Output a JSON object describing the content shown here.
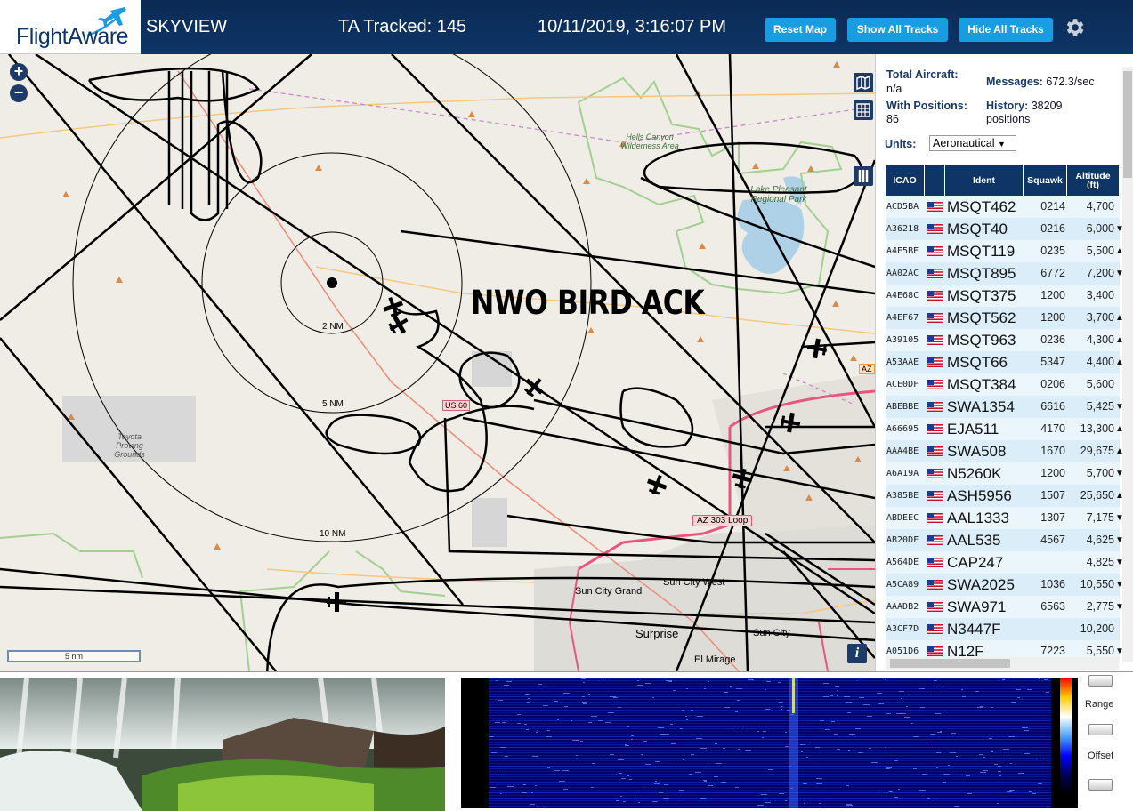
{
  "header": {
    "logo": "FlightAware",
    "app_title": "SKYVIEW",
    "tracked": "TA Tracked: 145",
    "datetime": "10/11/2019, 3:16:07 PM",
    "buttons": {
      "reset": "Reset Map",
      "show_all": "Show All Tracks",
      "hide_all": "Hide All Tracks"
    },
    "brand_color": "#1a9de0",
    "bar_color": "#0e3566"
  },
  "map": {
    "zoom_in": "+",
    "zoom_out": "−",
    "overlay_text": "NWO BIRD ACK",
    "ring_labels": [
      "2 NM",
      "5 NM",
      "10 NM"
    ],
    "place_labels": {
      "hells_canyon": "Hells Canyon Wilderness Area",
      "lake_pleasant": "Lake Pleasant Regional Park",
      "toyota": "Toyota Proving Grounds",
      "sun_city_grand": "Sun City Grand",
      "sun_city_west": "Sun City West",
      "surprise": "Surprise",
      "sun_city": "Sun City",
      "el_mirage": "El Mirage",
      "loop303": "AZ 303 Loop",
      "us60": "US 60",
      "az": "AZ"
    },
    "scale": "5 nm",
    "info": "i"
  },
  "sidebar": {
    "total_aircraft_label": "Total Aircraft:",
    "total_aircraft_value": "n/a",
    "messages_label": "Messages:",
    "messages_value": "672.3/sec",
    "with_positions_label": "With Positions:",
    "with_positions_value": "86",
    "history_label": "History:",
    "history_value": "38209",
    "history_unit": "positions",
    "units_label": "Units:",
    "units_value": "Aeronautical",
    "columns": [
      "ICAO",
      "",
      "Ident",
      "Squawk",
      "Altitude (ft)"
    ],
    "rows": [
      {
        "icao": "ACD5BA",
        "ident": "MSQT462",
        "squawk": "0214",
        "alt": "4,700",
        "trend": ""
      },
      {
        "icao": "A36218",
        "ident": "MSQT40",
        "squawk": "0216",
        "alt": "6,000",
        "trend": "▼"
      },
      {
        "icao": "A4E5BE",
        "ident": "MSQT119",
        "squawk": "0235",
        "alt": "5,500",
        "trend": "▲"
      },
      {
        "icao": "AA02AC",
        "ident": "MSQT895",
        "squawk": "6772",
        "alt": "7,200",
        "trend": "▼"
      },
      {
        "icao": "A4E68C",
        "ident": "MSQT375",
        "squawk": "1200",
        "alt": "3,400",
        "trend": ""
      },
      {
        "icao": "A4EF67",
        "ident": "MSQT562",
        "squawk": "1200",
        "alt": "3,700",
        "trend": "▲"
      },
      {
        "icao": "A39105",
        "ident": "MSQT963",
        "squawk": "0236",
        "alt": "4,300",
        "trend": "▲"
      },
      {
        "icao": "A53AAE",
        "ident": "MSQT66",
        "squawk": "5347",
        "alt": "4,400",
        "trend": "▲"
      },
      {
        "icao": "ACE0DF",
        "ident": "MSQT384",
        "squawk": "0206",
        "alt": "5,600",
        "trend": ""
      },
      {
        "icao": "ABEBBE",
        "ident": "SWA1354",
        "squawk": "6616",
        "alt": "5,425",
        "trend": "▼"
      },
      {
        "icao": "A66695",
        "ident": "EJA511",
        "squawk": "4170",
        "alt": "13,300",
        "trend": "▲"
      },
      {
        "icao": "AAA4BE",
        "ident": "SWA508",
        "squawk": "1670",
        "alt": "29,675",
        "trend": "▲"
      },
      {
        "icao": "A6A19A",
        "ident": "N5260K",
        "squawk": "1200",
        "alt": "5,700",
        "trend": "▼"
      },
      {
        "icao": "A385BE",
        "ident": "ASH5956",
        "squawk": "1507",
        "alt": "25,650",
        "trend": "▲"
      },
      {
        "icao": "ABDEEC",
        "ident": "AAL1333",
        "squawk": "1307",
        "alt": "7,175",
        "trend": "▼"
      },
      {
        "icao": "AB20DF",
        "ident": "AAL535",
        "squawk": "4567",
        "alt": "4,625",
        "trend": "▼"
      },
      {
        "icao": "A564DE",
        "ident": "CAP247",
        "squawk": "",
        "alt": "4,825",
        "trend": "▼"
      },
      {
        "icao": "A5CA89",
        "ident": "SWA2025",
        "squawk": "1036",
        "alt": "10,550",
        "trend": "▼"
      },
      {
        "icao": "AAADB2",
        "ident": "SWA971",
        "squawk": "6563",
        "alt": "2,775",
        "trend": "▼"
      },
      {
        "icao": "A3CF7D",
        "ident": "N3447F",
        "squawk": "",
        "alt": "10,200",
        "trend": ""
      },
      {
        "icao": "A051D6",
        "ident": "N12F",
        "squawk": "7223",
        "alt": "5,550",
        "trend": "▼"
      }
    ]
  },
  "bottom": {
    "range_label": "Range",
    "offset_label": "Offset"
  }
}
